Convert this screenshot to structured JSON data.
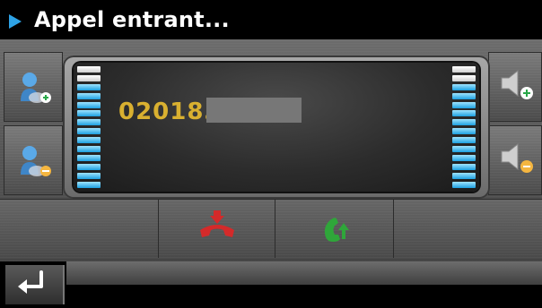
{
  "header": {
    "title": "Appel entrant..."
  },
  "call": {
    "number": "020183"
  },
  "icons": {
    "add_contact": "add-contact-icon",
    "remove_contact": "remove-contact-icon",
    "volume_up": "volume-up-icon",
    "volume_down": "volume-down-icon",
    "hang_up": "hang-up-icon",
    "answer": "answer-call-icon",
    "back": "back-icon"
  },
  "colors": {
    "title_arrow": "#2ea3e6",
    "number": "#d9b030",
    "hang_up": "#d42a2a",
    "answer": "#2fa63a"
  }
}
